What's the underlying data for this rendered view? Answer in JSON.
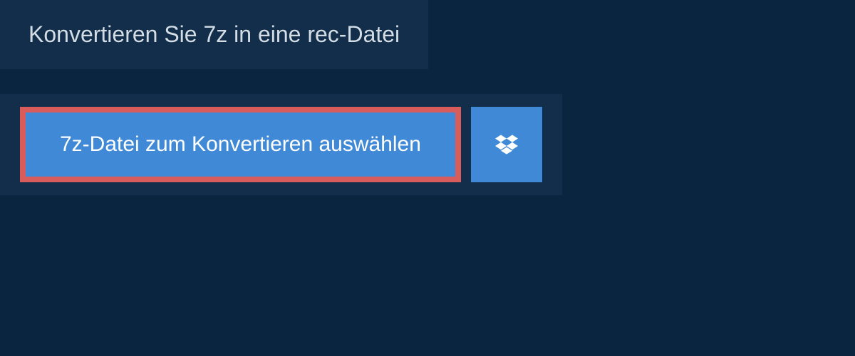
{
  "header": {
    "title": "Konvertieren Sie 7z in eine rec-Datei"
  },
  "actions": {
    "select_file_label": "7z-Datei zum Konvertieren auswählen",
    "dropbox_icon_name": "dropbox-icon"
  },
  "colors": {
    "background": "#0a2540",
    "panel": "#122e4a",
    "button": "#4089d6",
    "highlight_border": "#d95c5c"
  }
}
